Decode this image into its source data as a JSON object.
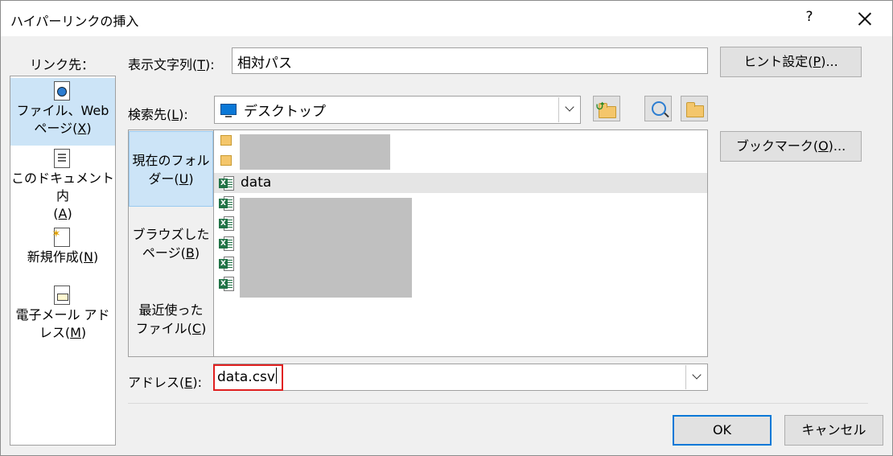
{
  "window": {
    "title": "ハイパーリンクの挿入",
    "help_label": "?"
  },
  "link_to": {
    "label": "リンク先：",
    "items": [
      {
        "line1": "ファイル、Web",
        "line2": "ページ(",
        "key": "X",
        "line2_end": ")",
        "icon": "web-page-icon"
      },
      {
        "line1": "このドキュメント内",
        "line2": "(",
        "key": "A",
        "line2_end": ")",
        "icon": "document-icon"
      },
      {
        "line1": "新規作成(",
        "key": "N",
        "line1_end": ")",
        "icon": "new-document-icon"
      },
      {
        "line1": "電子メール アド",
        "line2": "レス(",
        "key": "M",
        "line2_end": ")",
        "icon": "email-icon"
      }
    ]
  },
  "display_text": {
    "label_prefix": "表示文字列(",
    "key": "T",
    "label_suffix": "):",
    "value": "相対パス"
  },
  "screen_tip_button": {
    "prefix": "ヒント設定(",
    "key": "P",
    "suffix": ")..."
  },
  "look_in": {
    "label_prefix": "検索先(",
    "key": "L",
    "label_suffix": "):",
    "value": "デスクトップ"
  },
  "bookmark_button": {
    "prefix": "ブックマーク(",
    "key": "O",
    "suffix": ")..."
  },
  "folder_nav": [
    {
      "line1": "現在のフォル",
      "line2": "ダー(",
      "key": "U",
      "line2_end": ")"
    },
    {
      "line1": "ブラウズした",
      "line2": "ページ(",
      "key": "B",
      "line2_end": ")"
    },
    {
      "line1": "最近使った",
      "line2": "ファイル(",
      "key": "C",
      "line2_end": ")"
    }
  ],
  "files": {
    "visible_name": "data"
  },
  "address": {
    "label_prefix": "アドレス(",
    "key": "E",
    "label_suffix": "):",
    "value": "data.csv"
  },
  "ok_label": "OK",
  "cancel_label": "キャンセル"
}
